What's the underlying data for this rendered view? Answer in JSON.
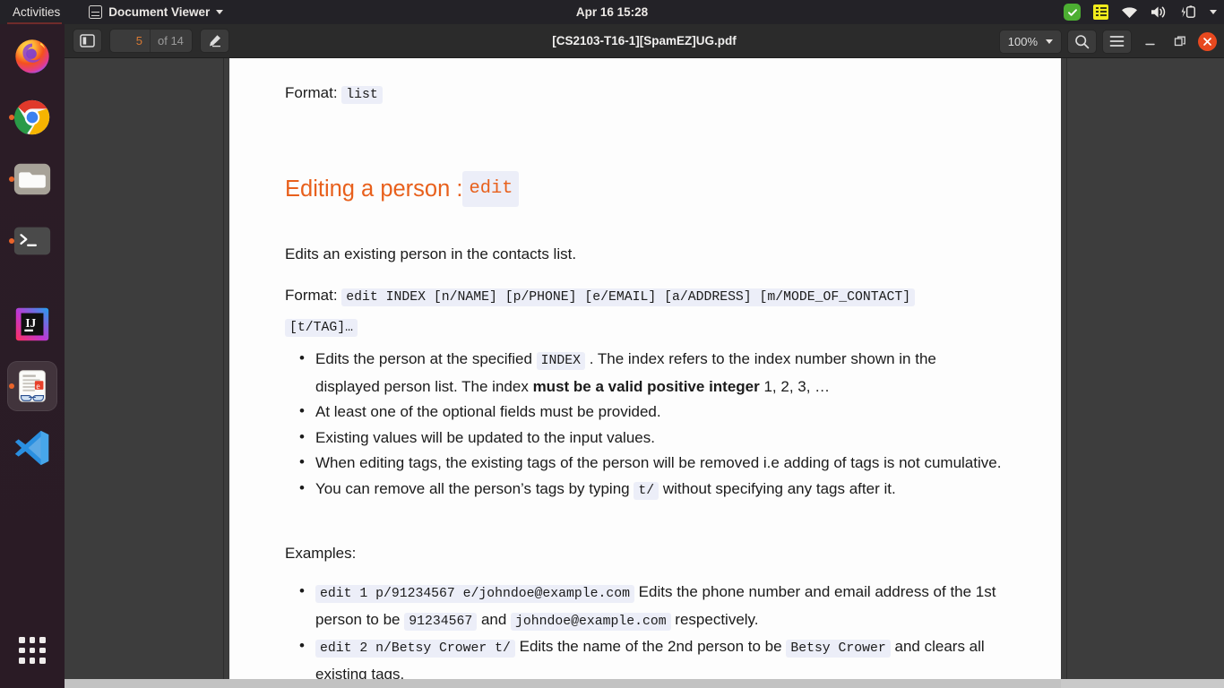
{
  "topbar": {
    "activities": "Activities",
    "app_name": "Document Viewer",
    "clock": "Apr 16  15:28",
    "icons": {
      "app": "document-viewer-icon",
      "menu_caret": "chevron-down-icon",
      "check": "check-circle-icon",
      "notes": "notes-icon",
      "wifi": "wifi-icon",
      "volume": "volume-icon",
      "battery": "battery-charging-icon",
      "system_caret": "chevron-down-icon"
    }
  },
  "dock": {
    "items": [
      {
        "name": "firefox",
        "label": "Firefox",
        "running": false,
        "active": false
      },
      {
        "name": "chrome",
        "label": "Google Chrome",
        "running": true,
        "active": false
      },
      {
        "name": "files",
        "label": "Files",
        "running": true,
        "active": false
      },
      {
        "name": "terminal",
        "label": "Terminal",
        "running": true,
        "active": false
      },
      {
        "name": "intellij",
        "label": "IntelliJ IDEA",
        "running": false,
        "active": false
      },
      {
        "name": "document-viewer",
        "label": "Document Viewer",
        "running": true,
        "active": true
      },
      {
        "name": "vscode",
        "label": "Visual Studio Code",
        "running": false,
        "active": false
      }
    ],
    "show_apps_label": "Show Applications"
  },
  "headerbar": {
    "sidebar_toggle": "toggle-sidebar-icon",
    "page_number": "5",
    "page_total": "of 14",
    "annotate": "annotation-icon",
    "title": "[CS2103-T16-1][SpamEZ]UG.pdf",
    "zoom_level": "100%",
    "search": "search-icon",
    "menu": "hamburger-menu-icon",
    "minimize": "minimize-icon",
    "maximize": "restore-icon",
    "close": "close-icon"
  },
  "document": {
    "format_list": {
      "label": "Format:",
      "code": "list"
    },
    "heading": {
      "text": "Editing a person : ",
      "code": "edit"
    },
    "intro": "Edits an existing person in the contacts list.",
    "format_edit": {
      "label": "Format:",
      "code_line1": "edit INDEX [n/NAME] [p/PHONE] [e/EMAIL] [a/ADDRESS] [m/MODE_OF_CONTACT]",
      "code_line2": "[t/TAG]…"
    },
    "bullets": [
      {
        "parts": [
          {
            "t": "text",
            "v": "Edits the person at the specified "
          },
          {
            "t": "code",
            "v": "INDEX"
          },
          {
            "t": "text",
            "v": " . The index refers to the index number shown in the displayed person list. The index "
          },
          {
            "t": "bold",
            "v": "must be a valid positive integer"
          },
          {
            "t": "text",
            "v": " 1, 2, 3, …"
          }
        ]
      },
      {
        "parts": [
          {
            "t": "text",
            "v": "At least one of the optional fields must be provided."
          }
        ]
      },
      {
        "parts": [
          {
            "t": "text",
            "v": "Existing values will be updated to the input values."
          }
        ]
      },
      {
        "parts": [
          {
            "t": "text",
            "v": "When editing tags, the existing tags of the person will be removed i.e adding of tags is not cumulative."
          }
        ]
      },
      {
        "parts": [
          {
            "t": "text",
            "v": "You can remove all the person’s tags by typing "
          },
          {
            "t": "code",
            "v": "t/"
          },
          {
            "t": "text",
            "v": " without specifying any tags after it."
          }
        ]
      }
    ],
    "examples_label": "Examples:",
    "examples": [
      {
        "parts": [
          {
            "t": "code",
            "v": "edit 1 p/91234567 e/johndoe@example.com"
          },
          {
            "t": "text",
            "v": " Edits the phone number and email address of the 1st person to be "
          },
          {
            "t": "code",
            "v": "91234567"
          },
          {
            "t": "text",
            "v": " and "
          },
          {
            "t": "code",
            "v": "johndoe@example.com"
          },
          {
            "t": "text",
            "v": " respectively."
          }
        ]
      },
      {
        "parts": [
          {
            "t": "code",
            "v": "edit 2 n/Betsy Crower t/"
          },
          {
            "t": "text",
            "v": " Edits the name of the 2nd person to be "
          },
          {
            "t": "code",
            "v": "Betsy Crower"
          },
          {
            "t": "text",
            "v": " and clears all existing tags."
          }
        ]
      }
    ]
  },
  "colors": {
    "heading_orange": "#e8601c",
    "code_bg": "#eceef8",
    "topbar_bg": "#232227",
    "dock_bg": "#2c1d27",
    "headerbar_bg": "#2b2b2b",
    "doc_bg": "#3d3d3d",
    "page_bg": "#fdfdfd",
    "close_red": "#e8491f",
    "page_num_orange": "#d97a33",
    "running_dot": "#e8642a"
  }
}
